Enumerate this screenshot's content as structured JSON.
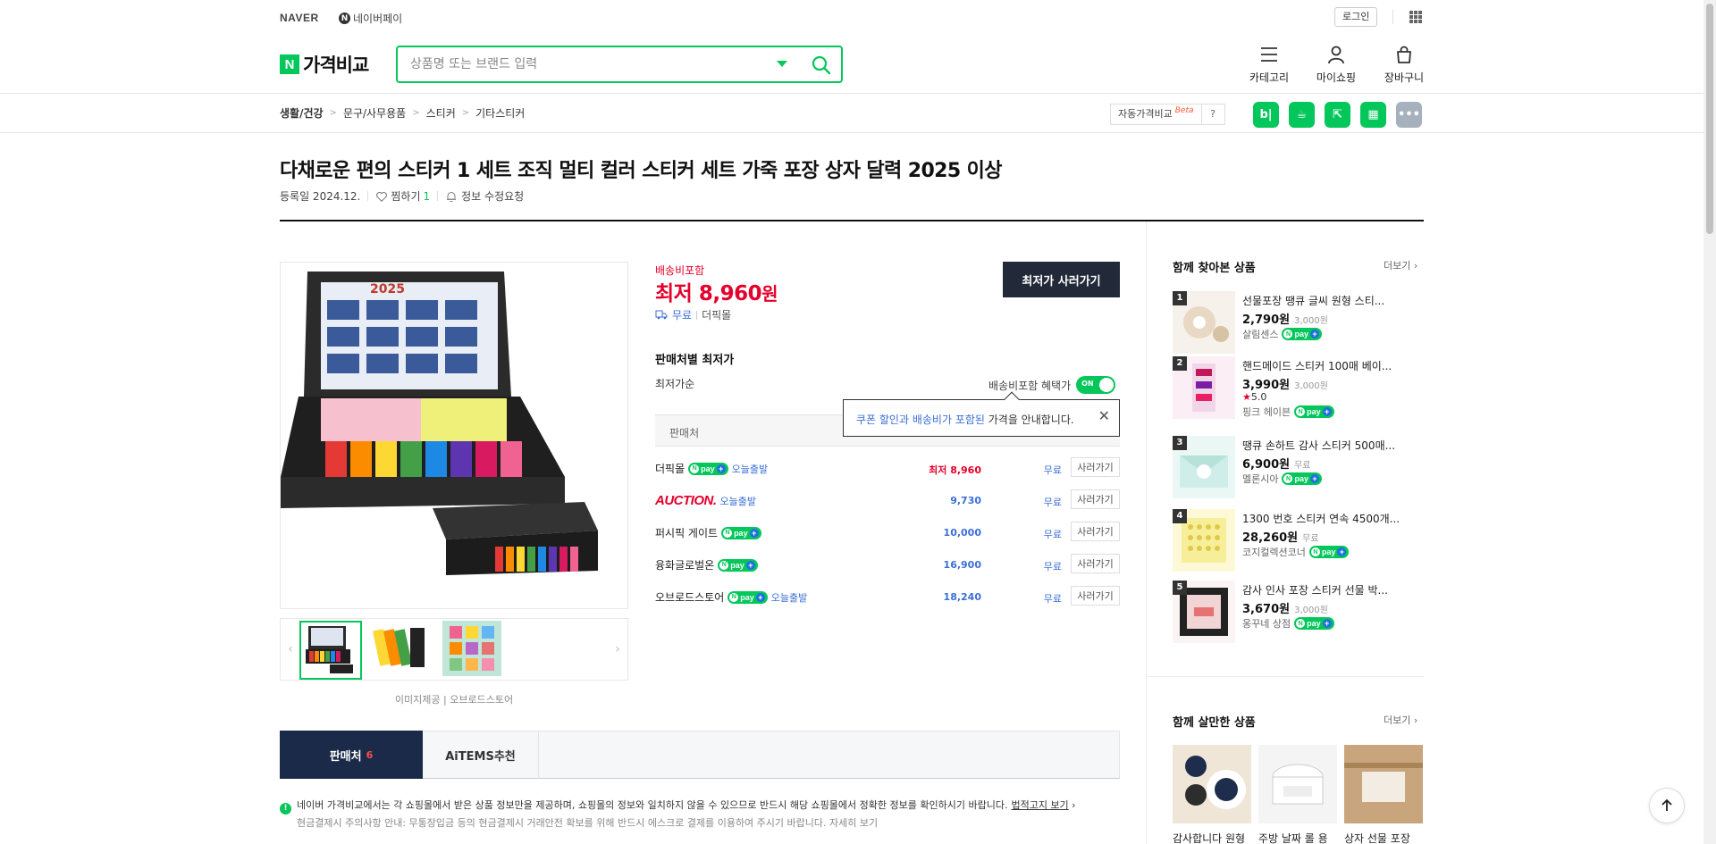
{
  "header": {
    "naver": "NAVER",
    "npay": "네이버페이",
    "login": "로그인",
    "brand": "가격비교",
    "brand_n": "N",
    "search_placeholder": "상품명 또는 브랜드 입력",
    "tools": [
      {
        "label": "카테고리",
        "icon": "menu-icon"
      },
      {
        "label": "마이쇼핑",
        "icon": "person-icon"
      },
      {
        "label": "장바구니",
        "icon": "cart-icon"
      }
    ]
  },
  "breadcrumb": [
    "생활/건강",
    "문구/사무용품",
    "스티커",
    "기타스티커"
  ],
  "auto_price": {
    "label": "자동가격비교",
    "beta": "Beta",
    "help": "?"
  },
  "quick_apps": [
    {
      "name": "blog",
      "glyph": "b|",
      "color": "#03c75a"
    },
    {
      "name": "cafe",
      "glyph": "☕",
      "color": "#03c75a"
    },
    {
      "name": "kakao",
      "glyph": "⇱",
      "color": "#03c75a"
    },
    {
      "name": "band",
      "glyph": "▦",
      "color": "#03c75a"
    },
    {
      "name": "more",
      "glyph": "•••",
      "color": "#a7b1bd"
    }
  ],
  "product": {
    "title": "다채로운 편의 스티커 1 세트 조직 멀티 컬러 스티커 세트 가죽 포장 상자 달력 2025 이상",
    "reg_date": "등록일 2024.12.",
    "wish_label": "찜하기",
    "wish_count": "1",
    "report": "정보 수정요청",
    "image_source": "이미지제공 | 오브로드스토어"
  },
  "price": {
    "ship_included": "배송비포함",
    "lowest_label": "최저",
    "lowest_value": "8,960",
    "won": "원",
    "ship_free": "무료",
    "shop": "더픽몰",
    "buy_button": "최저가 사러가기"
  },
  "sellers": {
    "title": "판매처별 최저가",
    "sort": "최저가순",
    "benefit": "배송비포함 혜택가",
    "toggle": "ON",
    "header": "판매처",
    "tooltip_hl": "쿠폰 할인과 배송비가 포함된",
    "tooltip_rest": " 가격을 안내합니다.",
    "rows": [
      {
        "name": "더픽몰",
        "npay": true,
        "today": "오늘출발",
        "price": "최저 8,960",
        "best": true,
        "ship": "무료",
        "buy": "사러가기",
        "logo": false
      },
      {
        "name": "AUCTION.",
        "npay": false,
        "today": "오늘출발",
        "price": "9,730",
        "best": false,
        "ship": "무료",
        "buy": "사러가기",
        "logo": true
      },
      {
        "name": "퍼시픽 게이트",
        "npay": true,
        "today": "",
        "price": "10,000",
        "best": false,
        "ship": "무료",
        "buy": "사러가기",
        "logo": false
      },
      {
        "name": "융화글로벌온",
        "npay": true,
        "today": "",
        "price": "16,900",
        "best": false,
        "ship": "무료",
        "buy": "사러가기",
        "logo": false
      },
      {
        "name": "오브로드스토어",
        "npay": true,
        "today": "오늘출발",
        "price": "18,240",
        "best": false,
        "ship": "무료",
        "buy": "사러가기",
        "logo": false
      }
    ]
  },
  "npay_badge": "pay",
  "tabs": {
    "active": "판매처",
    "active_count": "6",
    "other": "AiTEMS추천"
  },
  "notice": {
    "text": "네이버 가격비교에서는 각 쇼핑몰에서 받은 상품 정보만을 제공하며, 쇼핑몰의 정보와 일치하지 않을 수 있으므로 반드시 해당 쇼핑몰에서 정확한 정보를 확인하시기 바랍니다.",
    "link": "법적고지 보기",
    "line2": "현금결제시 주의사항 안내: 무통장입금 등의 현금결제시 거래안전 확보를 위해 반드시 에스크로 결제를 이용하여 주시기 바랍니다. 자세히 보기"
  },
  "sidebar": {
    "viewed_title": "함께 찾아본 상품",
    "more": "더보기",
    "viewed": [
      {
        "rank": "1",
        "name": "선물포장 땡큐 글씨 원형 스티...",
        "price": "2,790원",
        "ship": "3,000원",
        "rating": "",
        "seller": "살림센스",
        "npay": true,
        "img": "#e9d9c4"
      },
      {
        "rank": "2",
        "name": "핸드메이드 스티커 100매 베이...",
        "price": "3,990원",
        "ship": "3,000원",
        "rating": "5.0",
        "seller": "핑크 헤이븐",
        "npay": true,
        "img": "#f0d6e8"
      },
      {
        "rank": "3",
        "name": "땡큐 손하트 감사 스티커 500매...",
        "price": "6,900원",
        "ship": "무료",
        "rating": "",
        "seller": "멜론시아",
        "npay": true,
        "img": "#cfeee9"
      },
      {
        "rank": "4",
        "name": "1300 번호 스티커 연속 4500개...",
        "price": "28,260원",
        "ship": "무료",
        "rating": "",
        "seller": "코지컬렉션코너",
        "npay": true,
        "img": "#f7ee9a"
      },
      {
        "rank": "5",
        "name": "감사 인사 포장 스티커 선물 박...",
        "price": "3,670원",
        "ship": "3,000원",
        "rating": "",
        "seller": "옹꾸네 상점",
        "npay": true,
        "img": "#f1d4d4"
      }
    ],
    "bought_title": "함께 살만한 상품",
    "bought": [
      {
        "name": "감사합니다 원형",
        "img": "#efe6d8"
      },
      {
        "name": "주방 날짜 롤 용",
        "img": "#eeeeee"
      },
      {
        "name": "상자 선물 포장",
        "img": "#c8a57c"
      }
    ]
  },
  "colors": {
    "accent": "#03c75a",
    "price_red": "#e4002b",
    "link_blue": "#3b6fd6",
    "navy": "#1b2a48"
  }
}
